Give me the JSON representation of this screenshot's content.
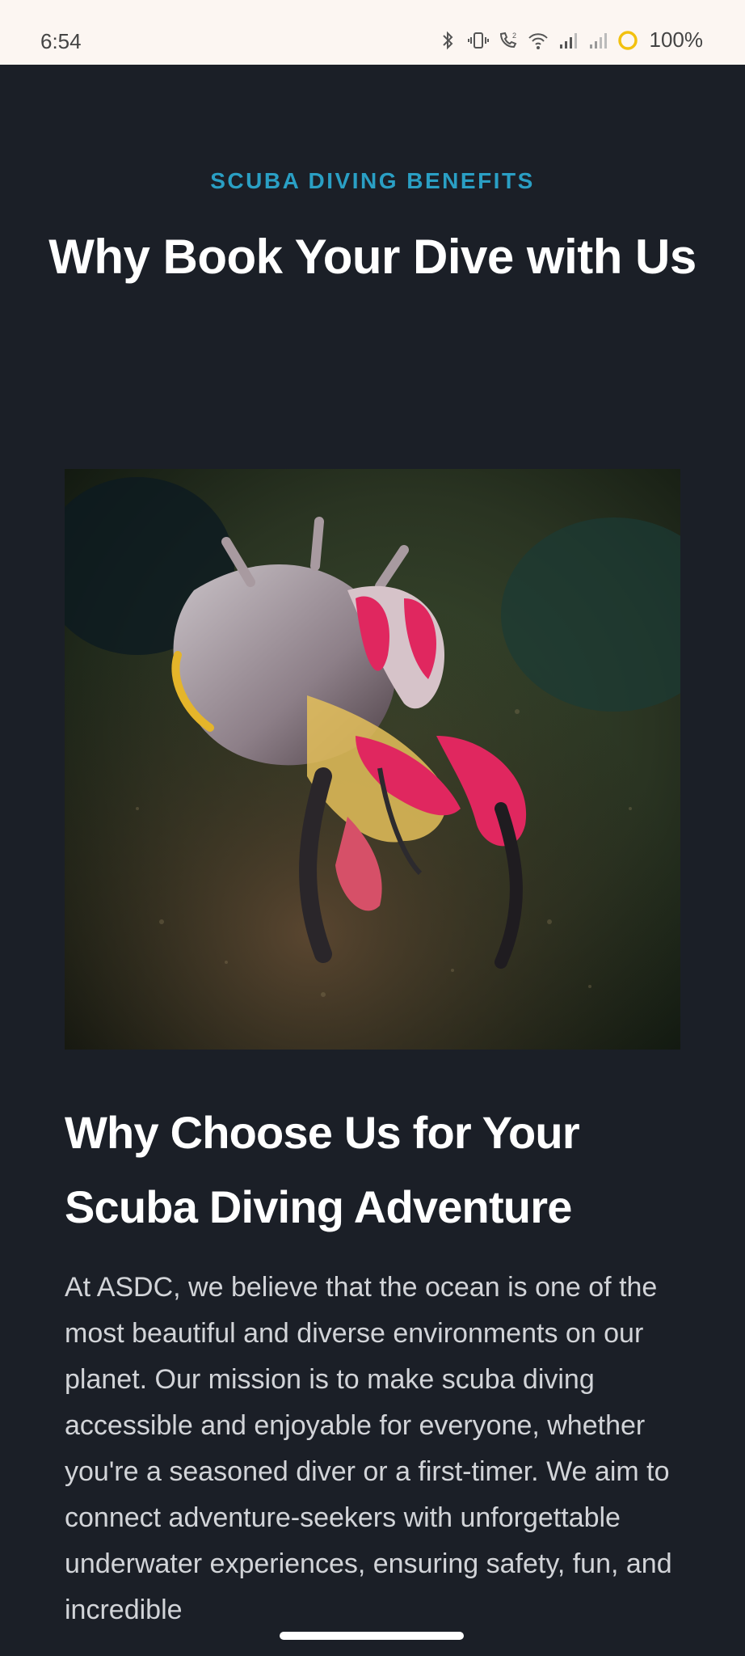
{
  "status_bar": {
    "time": "6:54",
    "battery": "100%",
    "icons": [
      "bluetooth-icon",
      "vibrate-icon",
      "wifi-call-icon",
      "wifi-icon",
      "signal-icon",
      "signal-icon-2",
      "battery-saver-icon"
    ]
  },
  "page": {
    "eyebrow": "SCUBA DIVING BENEFITS",
    "title": "Why Book Your Dive with Us",
    "section_title": "Why Choose Us for Your Scuba Diving Adventure",
    "body": "At ASDC, we believe that the ocean is one of the most beautiful and diverse environments on our planet. Our mission is to make scuba diving accessible and enjoyable for everyone, whether you're a seasoned diver or a first-timer. We aim to connect adventure-seekers with unforgettable underwater experiences, ensuring safety, fun, and incredible"
  },
  "colors": {
    "background": "#1b1f27",
    "accent": "#2a9fc4",
    "status_bar": "#fcf6f2"
  }
}
